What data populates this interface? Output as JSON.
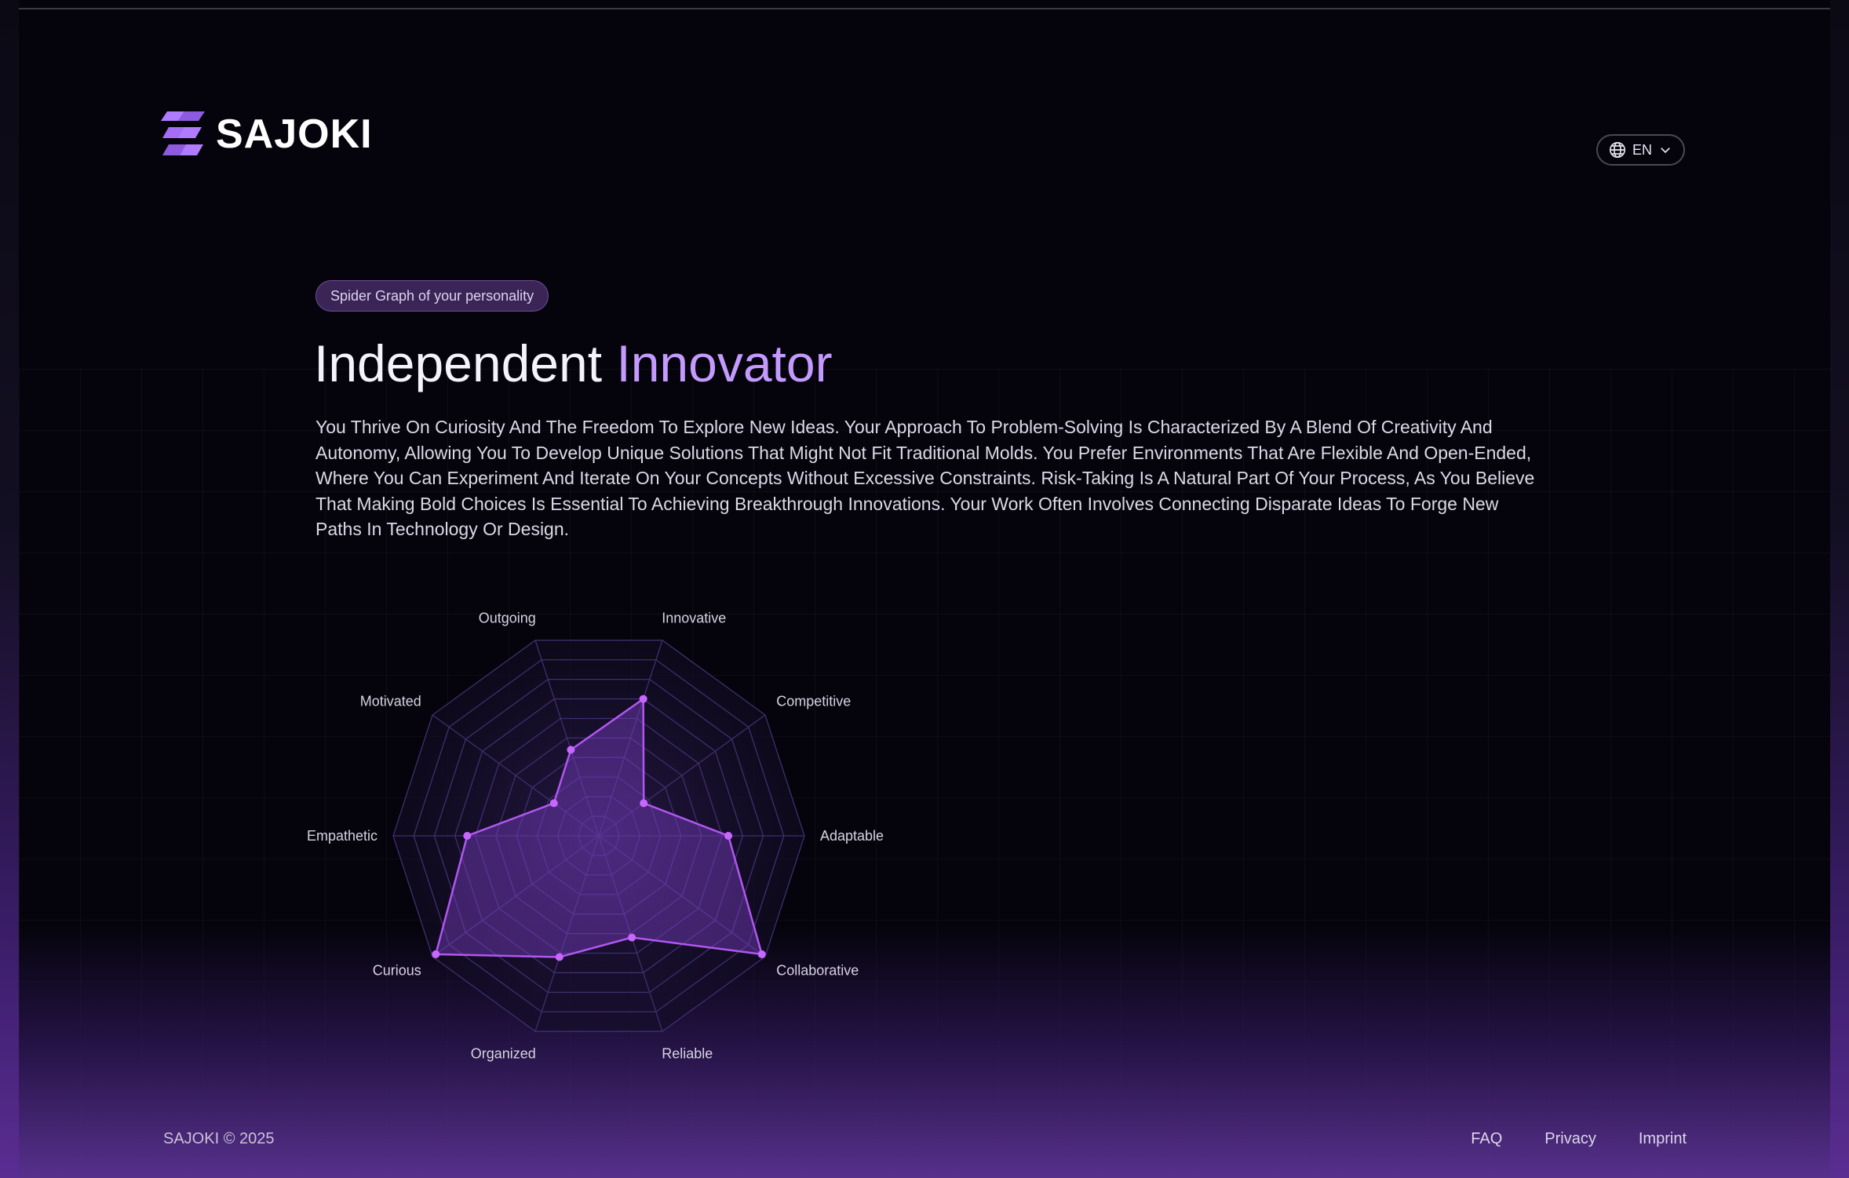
{
  "brand": {
    "name": "SAJOKI",
    "logo_icon": "sajoki-logo-icon"
  },
  "header": {
    "language_label": "EN",
    "language_icon": "globe-icon",
    "dropdown_icon": "chevron-down-icon"
  },
  "section": {
    "tag": "Spider Graph of your personality",
    "title_main": "Independent",
    "title_accent": "Innovator",
    "description": "You Thrive On Curiosity And The Freedom To Explore New Ideas. Your Approach To Problem-Solving Is Characterized By A Blend Of Creativity And Autonomy, Allowing You To Develop Unique Solutions That Might Not Fit Traditional Molds. You Prefer Environments That Are Flexible And Open-Ended, Where You Can Experiment And Iterate On Your Concepts Without Excessive Constraints. Risk-Taking Is A Natural Part Of Your Process, As You Believe That Making Bold Choices Is Essential To Achieving Breakthrough Innovations. Your Work Often Involves Connecting Disparate Ideas To Forge New Paths In Technology Or Design."
  },
  "chart_data": {
    "type": "radar",
    "categories": [
      "Innovative",
      "Competitive",
      "Adaptable",
      "Collaborative",
      "Reliable",
      "Organized",
      "Curious",
      "Empathetic",
      "Motivated",
      "Outgoing"
    ],
    "values": [
      0.7,
      0.27,
      0.63,
      0.98,
      0.52,
      0.62,
      0.98,
      0.64,
      0.27,
      0.44
    ],
    "rings": 10,
    "range": [
      0,
      1
    ],
    "colors": {
      "fill": "#7b3fc4",
      "stroke": "#b057f0",
      "point": "#c866ff",
      "grid": "#3f2f6e"
    }
  },
  "footer": {
    "copyright": "SAJOKI © 2025",
    "links": [
      "FAQ",
      "Privacy",
      "Imprint"
    ]
  }
}
